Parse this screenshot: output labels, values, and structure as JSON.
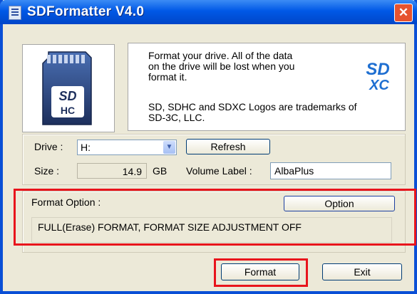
{
  "window": {
    "title": "SDFormatter V4.0",
    "close_label": "✕"
  },
  "card": {
    "label_top": "SD",
    "label_bottom": "HC"
  },
  "info": {
    "description": "Format your drive. All of the data\non the drive will be lost when you\nformat it.",
    "trademark": "SD, SDHC and SDXC Logos are trademarks of\nSD-3C, LLC.",
    "logo_text_top": "SD",
    "logo_text_bottom": "XC"
  },
  "drive": {
    "label": "Drive :",
    "value": "H:",
    "refresh_label": "Refresh"
  },
  "size": {
    "label": "Size :",
    "value": "14.9",
    "unit": "GB"
  },
  "volume": {
    "label": "Volume Label :",
    "value": "AlbaPlus"
  },
  "format_option": {
    "label": "Format Option :",
    "option_label": "Option",
    "summary": "FULL(Erase) FORMAT, FORMAT SIZE ADJUSTMENT OFF"
  },
  "actions": {
    "format_label": "Format",
    "exit_label": "Exit"
  },
  "colors": {
    "titlebar": "#0058e6",
    "highlight": "#e8141c",
    "dialog": "#ece9d8"
  }
}
